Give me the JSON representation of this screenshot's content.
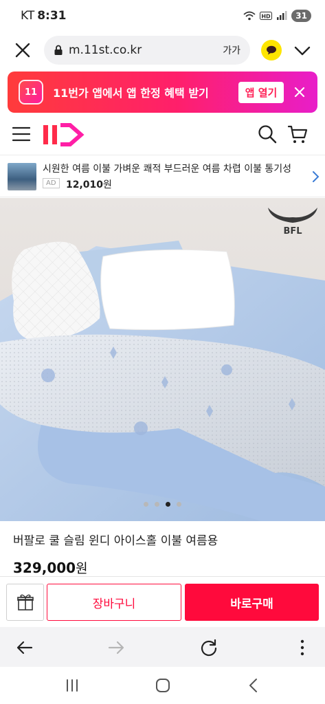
{
  "status_bar": {
    "carrier": "KT",
    "time": "8:31",
    "battery": "31"
  },
  "browser": {
    "url": "m.11st.co.kr",
    "text_size_label": "가가"
  },
  "app_banner": {
    "message": "11번가 앱에서 앱 한정 혜택 받기",
    "open_label": "앱 열기",
    "logo_text": "11"
  },
  "ad": {
    "title": "시원한 여름 이불 가벼운 쾌적 부드러운 여름 차렵 이불 통기성",
    "badge": "AD",
    "price": "12,010",
    "unit": "원"
  },
  "product": {
    "brand_mark": "BFL",
    "title": "버팔로 쿨 슬림 윈디 아이스홀 이불 여름용",
    "price": "329,000",
    "unit": "원",
    "carousel": {
      "total": 4,
      "current": 3
    }
  },
  "buy_bar": {
    "cart_label": "장바구니",
    "buy_label": "바로구매"
  },
  "colors": {
    "accent": "#ff0a3c",
    "banner_start": "#ff3b3b",
    "banner_end": "#e81ec9",
    "kakao": "#fee500"
  }
}
